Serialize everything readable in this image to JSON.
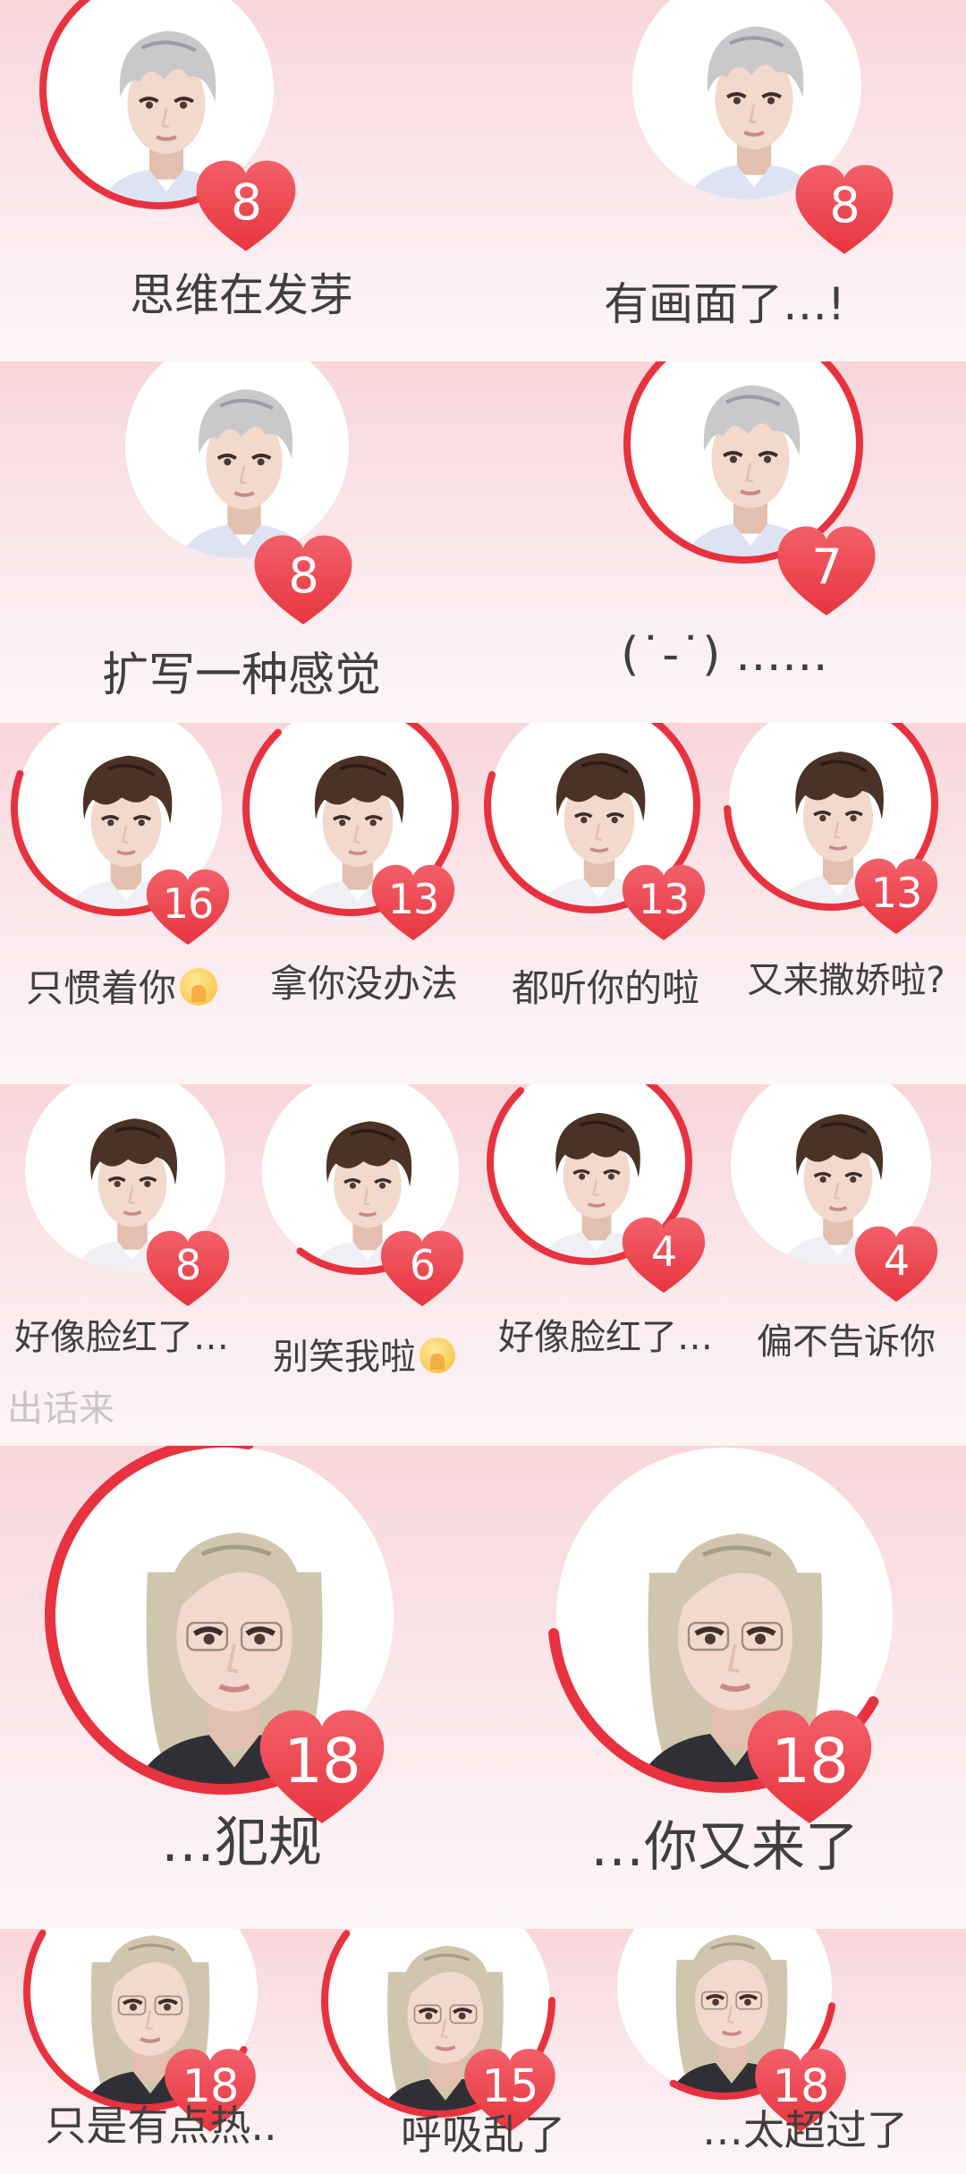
{
  "colors": {
    "accent": "#e8323f",
    "heart": "#e8353f",
    "heart_light": "#f2606a",
    "caption": "#3f3f3f",
    "background": "#f9e4e7",
    "silver_hair": "#c9c9cc",
    "brown_hair": "#4a3326",
    "blond_hair": "#cfc6ad"
  },
  "cards": [
    {
      "caption": "思维在发芽",
      "count": "8",
      "character": "silver-hair-boy",
      "ring_progress": 0.45,
      "emoji": null
    },
    {
      "caption": "有画面了…!",
      "count": "8",
      "character": "silver-hair-boy",
      "ring_progress": 0,
      "emoji": null
    },
    {
      "caption": "扩写一种感觉",
      "count": "8",
      "character": "silver-hair-boy",
      "ring_progress": 0,
      "emoji": null
    },
    {
      "caption": "(˙-˙) ……",
      "count": "7",
      "character": "silver-hair-boy",
      "ring_progress": 0.82,
      "emoji": null
    },
    {
      "caption": "只惯着你",
      "count": "16",
      "character": "brown-hair-boy",
      "ring_progress": 0.4,
      "emoji": "pleading-face-emoji"
    },
    {
      "caption": "拿你没办法",
      "count": "13",
      "character": "brown-hair-boy",
      "ring_progress": 0.85,
      "emoji": null
    },
    {
      "caption": "都听你的啦",
      "count": "13",
      "character": "brown-hair-boy",
      "ring_progress": 0.88,
      "emoji": null
    },
    {
      "caption": "又来撒娇啦?",
      "count": "13",
      "character": "brown-hair-boy",
      "ring_progress": 0.7,
      "emoji": null
    },
    {
      "caption": "好像脸红了…",
      "count": "8",
      "character": "brown-hair-boy",
      "ring_progress": 0,
      "emoji": null
    },
    {
      "caption": "别笑我啦",
      "count": "6",
      "character": "brown-hair-boy",
      "ring_progress": 0.2,
      "emoji": "pleading-face-emoji"
    },
    {
      "caption": "好像脸红了…",
      "count": "4",
      "character": "brown-hair-boy",
      "ring_progress": 0.85,
      "emoji": null
    },
    {
      "caption": "偏不告诉你",
      "count": "4",
      "character": "brown-hair-boy",
      "ring_progress": 0,
      "emoji": null
    },
    {
      "caption": "…犯规",
      "count": "18",
      "character": "blond-hair-man",
      "ring_progress": 0.62,
      "emoji": null
    },
    {
      "caption": "…你又来了",
      "count": "18",
      "character": "blond-hair-man",
      "ring_progress": 0.4,
      "emoji": null
    },
    {
      "caption": "只是有点热..",
      "count": "18",
      "character": "blond-hair-man",
      "ring_progress": 0.5,
      "emoji": null
    },
    {
      "caption": "呼吸乱了",
      "count": "15",
      "character": "blond-hair-man",
      "ring_progress": 0.6,
      "emoji": null
    },
    {
      "caption": "…太超过了",
      "count": "18",
      "character": "blond-hair-man",
      "ring_progress": 0.3,
      "emoji": null
    }
  ],
  "faded_caption": "出话来"
}
